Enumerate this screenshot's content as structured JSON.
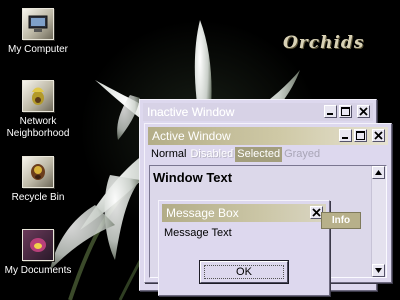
{
  "desktop": {
    "wallpaper_title": "Orchids",
    "icons": [
      {
        "label": "My Computer",
        "icon": "computer-icon"
      },
      {
        "label": "Network Neighborhood",
        "icon": "network-icon"
      },
      {
        "label": "Recycle Bin",
        "icon": "recycle-bin-icon"
      },
      {
        "label": "My Documents",
        "icon": "documents-icon"
      }
    ]
  },
  "inactive_window": {
    "title": "Inactive Window"
  },
  "active_window": {
    "title": "Active Window",
    "menu": {
      "normal": "Normal",
      "disabled": "Disabled",
      "selected": "Selected",
      "grayed": "Grayed"
    },
    "body_text": "Window Text"
  },
  "message_box": {
    "title": "Message Box",
    "text": "Message Text",
    "ok_label": "OK"
  },
  "tooltip": {
    "text": "Info"
  },
  "colors": {
    "window_background": "#ddd8ee",
    "active_title_gradient_start": "#b3ad88",
    "selection": "#a39e7d",
    "tooltip_background": "#b7b08a",
    "desktop_background": "#000000"
  }
}
